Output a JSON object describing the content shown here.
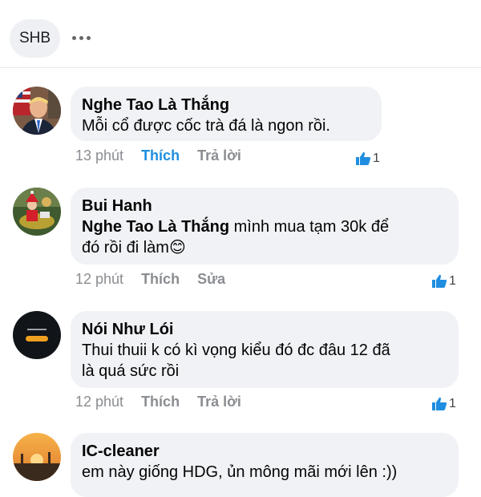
{
  "header": {
    "chip_label": "SHB",
    "more_icon": "more-horizontal-icon"
  },
  "colors": {
    "bubble": "#f0f2f5",
    "like_active": "#1f8ee0",
    "meta": "#8a8d91",
    "thumb": "#1f8ee0"
  },
  "comments": [
    {
      "author": "Nghe Tao Là Thắng",
      "text": "Mỗi cổ được cốc trà đá là ngon rồi.",
      "time": "13 phút",
      "like_label": "Thích",
      "reply_label": "Trả lời",
      "like_count": "1",
      "liked": true
    },
    {
      "author": "Bui Hanh",
      "mention": "Nghe Tao Là Thắng",
      "text_line1": " mình mua tạm 30k để",
      "text_line2": "đó rồi đi làm",
      "emoji": "😊",
      "time": "12 phút",
      "like_label": "Thích",
      "reply_label": "Sửa",
      "like_count": "1",
      "liked": false
    },
    {
      "author": "Nói Như Lói",
      "text_line1": "Thui thuii k có kì vọng kiểu đó đc đâu 12 đã",
      "text_line2": "là quá sức rồi",
      "time": "12 phút",
      "like_label": "Thích",
      "reply_label": "Trả lời",
      "like_count": "1",
      "liked": false
    },
    {
      "author": "IC-cleaner",
      "text": "em này giống HDG, ủn mông mãi mới lên :))"
    }
  ]
}
